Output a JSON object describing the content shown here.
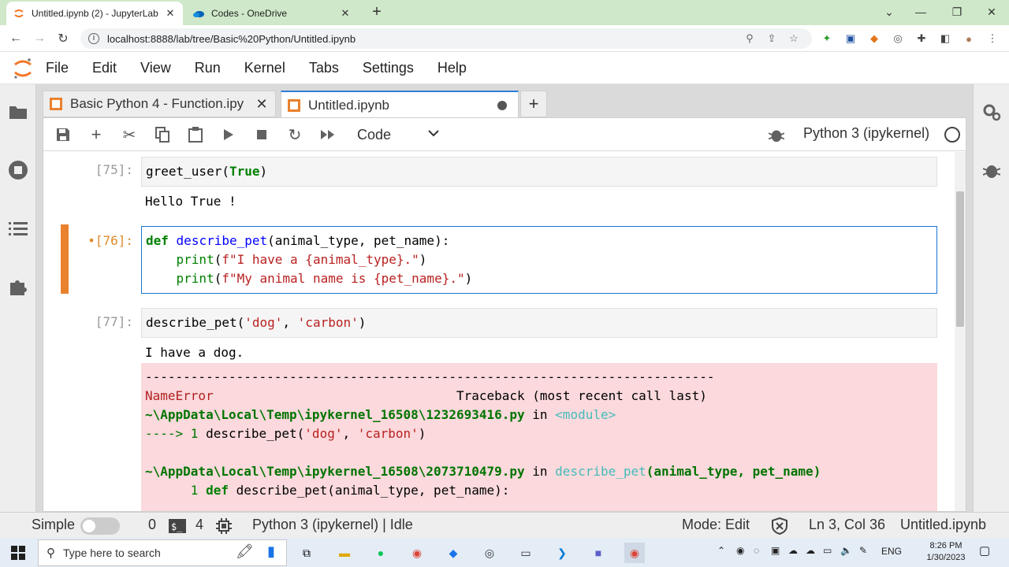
{
  "browser": {
    "tabs": [
      {
        "title": "Untitled.ipynb (2) - JupyterLab",
        "icon": "jupyter-icon",
        "active": true
      },
      {
        "title": "Codes - OneDrive",
        "icon": "onedrive-icon",
        "active": false
      }
    ],
    "url": "localhost:8888/lab/tree/Basic%20Python/Untitled.ipynb"
  },
  "menu": [
    "File",
    "Edit",
    "View",
    "Run",
    "Kernel",
    "Tabs",
    "Settings",
    "Help"
  ],
  "doc_tabs": [
    {
      "label": "Basic Python 4 - Function.ipy"
    },
    {
      "label": "Untitled.ipynb"
    }
  ],
  "toolbar": {
    "cell_type": "Code",
    "kernel": "Python 3 (ipykernel)"
  },
  "cells": {
    "c75": {
      "prompt": "[75]:",
      "code_fn": "greet_user(",
      "code_arg": "True",
      "code_end": ")",
      "output": "Hello True !"
    },
    "c76": {
      "prompt": "•[76]:",
      "l1_def": "def",
      "l1_name": "describe_pet",
      "l1_rest": "(animal_type, pet_name):",
      "l2_indent": "    ",
      "l2_fn": "print",
      "l2_open": "(",
      "l2_str": "f\"I have a {animal_type}.\"",
      "l2_close": ")",
      "l3_fn": "print",
      "l3_str": "f\"My animal name is {pet_name}.\"",
      "l3_close": ")"
    },
    "c77": {
      "prompt": "[77]:",
      "code_fn": "describe_pet(",
      "code_s1": "'dog'",
      "code_sep": ", ",
      "code_s2": "'carbon'",
      "code_end": ")",
      "output": "I have a dog.",
      "err_rule": "---------------------------------------------------------------------------",
      "err_name": "NameError",
      "err_tb": "Traceback (most recent call last)",
      "err_path1": "~\\AppData\\Local\\Temp\\ipykernel_16508\\1232693416.py",
      "err_in": " in ",
      "err_mod": "<module>",
      "err_line1_arrow": "----> 1 ",
      "err_line1_code_fn": "describe_pet(",
      "err_line1_s1": "'dog'",
      "err_line1_sep": ", ",
      "err_line1_s2": "'carbon'",
      "err_line1_end": ")",
      "err_path2": "~\\AppData\\Local\\Temp\\ipykernel_16508\\2073710479.py",
      "err_fn": "describe_pet",
      "err_args": "(animal_type, pet_name)",
      "err_l2_num": "      1 ",
      "err_l2_def": "def",
      "err_l2_rest": " describe_pet(animal_type, pet_name):"
    }
  },
  "status": {
    "mode_label": "Simple",
    "count1": "0",
    "count2": "4",
    "kernel_status": "Python 3 (ipykernel) | Idle",
    "mode": "Mode: Edit",
    "cursor": "Ln 3, Col 36",
    "file": "Untitled.ipynb"
  },
  "taskbar": {
    "search_placeholder": "Type here to search",
    "lang": "ENG",
    "time": "8:26 PM",
    "date": "1/30/2023"
  },
  "colors": {
    "accent": "#e9812d",
    "active_cell_border": "#1976d2",
    "error_bg": "#fbd9dc"
  }
}
